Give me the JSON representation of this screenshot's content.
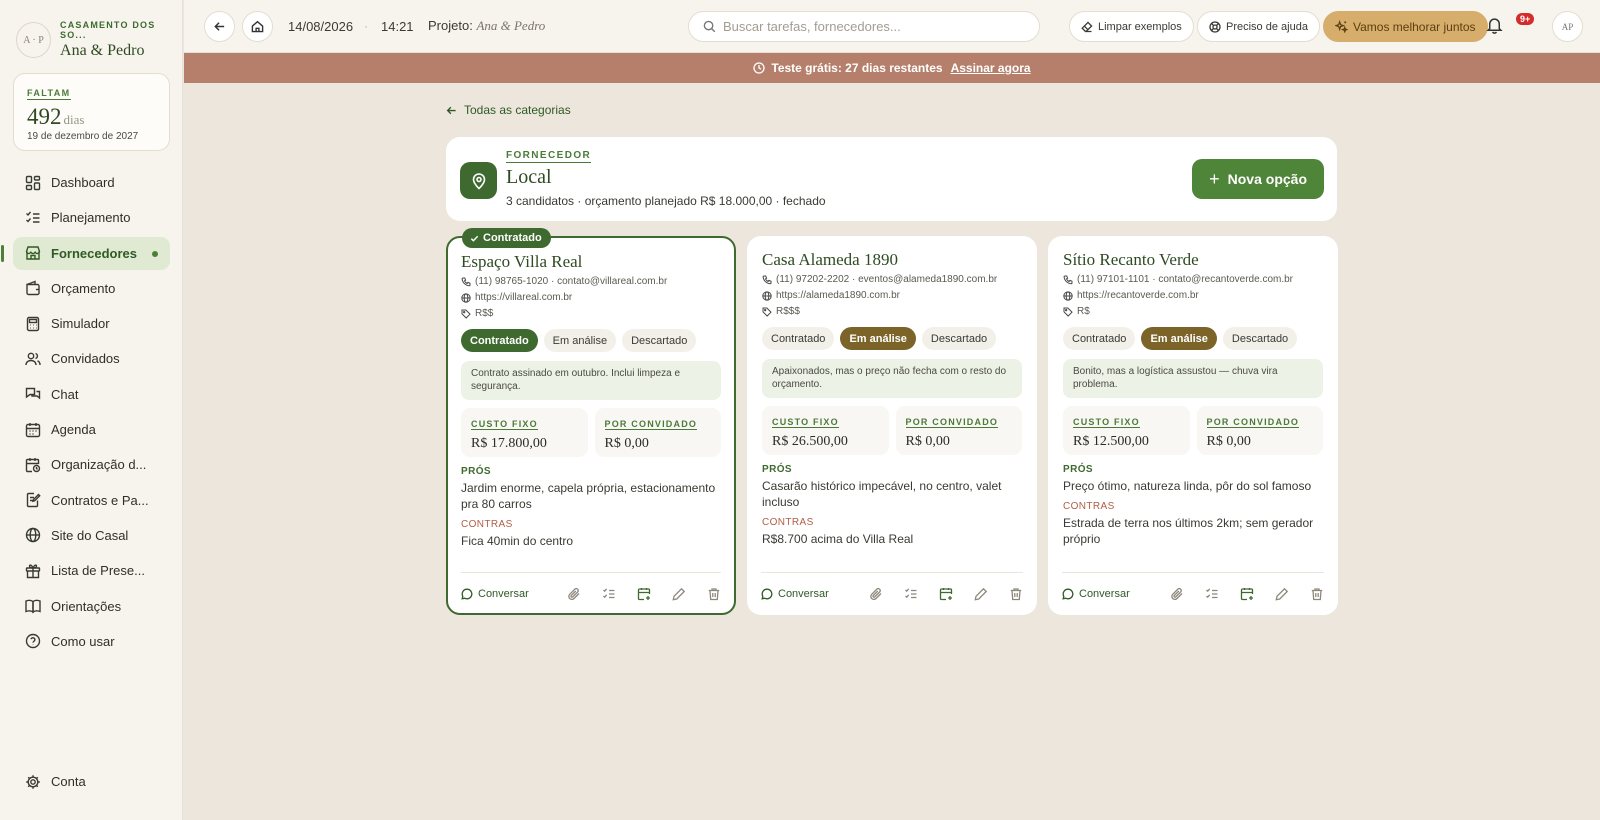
{
  "brand": {
    "monogram": "A · P",
    "kicker": "CASAMENTO DOS SO...",
    "names": "Ana & Pedro"
  },
  "countdown": {
    "kicker": "FALTAM",
    "number": "492",
    "unit": "dias",
    "date": "19 de dezembro de 2027"
  },
  "nav": [
    {
      "label": "Dashboard",
      "icon": "dashboard-icon"
    },
    {
      "label": "Planejamento",
      "icon": "checklist-icon"
    },
    {
      "label": "Fornecedores",
      "icon": "store-icon",
      "active": true
    },
    {
      "label": "Orçamento",
      "icon": "wallet-icon"
    },
    {
      "label": "Simulador",
      "icon": "calculator-icon"
    },
    {
      "label": "Convidados",
      "icon": "users-icon"
    },
    {
      "label": "Chat",
      "icon": "chat-icon"
    },
    {
      "label": "Agenda",
      "icon": "calendar-icon"
    },
    {
      "label": "Organização d...",
      "icon": "calendar-clock-icon"
    },
    {
      "label": "Contratos e Pa...",
      "icon": "contract-icon"
    },
    {
      "label": "Site do Casal",
      "icon": "globe-icon"
    },
    {
      "label": "Lista de Prese...",
      "icon": "gift-icon"
    },
    {
      "label": "Orientações",
      "icon": "book-icon"
    },
    {
      "label": "Como usar",
      "icon": "help-icon"
    }
  ],
  "nav_bottom": {
    "label": "Conta",
    "icon": "gear-icon"
  },
  "topbar": {
    "date": "14/08/2026",
    "sep": "·",
    "time": "14:21",
    "project_label": "Projeto:",
    "project_name": "Ana & Pedro",
    "search_placeholder": "Buscar tarefas, fornecedores...",
    "clear_examples": "Limpar exemplos",
    "need_help": "Preciso de ajuda",
    "improve": "Vamos melhorar juntos",
    "notif_badge": "9+",
    "avatar": "AP"
  },
  "trial": {
    "text": "Teste grátis: 27 dias restantes",
    "cta": "Assinar agora"
  },
  "back_link": "Todas as categorias",
  "category": {
    "kicker": "FORNECEDOR",
    "title": "Local",
    "summary": "3 candidatos · orçamento planejado R$ 18.000,00 · fechado",
    "new_option": "Nova opção"
  },
  "status_labels": [
    "Contratado",
    "Em análise",
    "Descartado"
  ],
  "labels": {
    "fixed_cost": "CUSTO FIXO",
    "per_guest": "POR CONVIDADO",
    "pros": "PRÓS",
    "cons": "CONTRAS",
    "chat": "Conversar",
    "hired_badge": "Contratado"
  },
  "vendors": [
    {
      "name": "Espaço Villa Real",
      "contact": "(11) 98765-1020 · contato@villareal.com.br",
      "site": "https://villareal.com.br",
      "price_tier": "R$$",
      "status": "Contratado",
      "note": "Contrato assinado em outubro. Inclui limpeza e segurança.",
      "fixed_cost": "R$ 17.800,00",
      "per_guest": "R$ 0,00",
      "pros": "Jardim enorme, capela própria, estacionamento pra 80 carros",
      "cons": "Fica 40min do centro"
    },
    {
      "name": "Casa Alameda 1890",
      "contact": "(11) 97202-2202 · eventos@alameda1890.com.br",
      "site": "https://alameda1890.com.br",
      "price_tier": "R$$$",
      "status": "Em análise",
      "note": "Apaixonados, mas o preço não fecha com o resto do orçamento.",
      "fixed_cost": "R$ 26.500,00",
      "per_guest": "R$ 0,00",
      "pros": "Casarão histórico impecável, no centro, valet incluso",
      "cons": "R$8.700 acima do Villa Real"
    },
    {
      "name": "Sítio Recanto Verde",
      "contact": "(11) 97101-1101 · contato@recantoverde.com.br",
      "site": "https://recantoverde.com.br",
      "price_tier": "R$",
      "status": "Em análise",
      "note": "Bonito, mas a logística assustou — chuva vira problema.",
      "fixed_cost": "R$ 12.500,00",
      "per_guest": "R$ 0,00",
      "pros": "Preço ótimo, natureza linda, pôr do sol famoso",
      "cons": "Estrada de terra nos últimos 2km; sem gerador próprio"
    }
  ]
}
